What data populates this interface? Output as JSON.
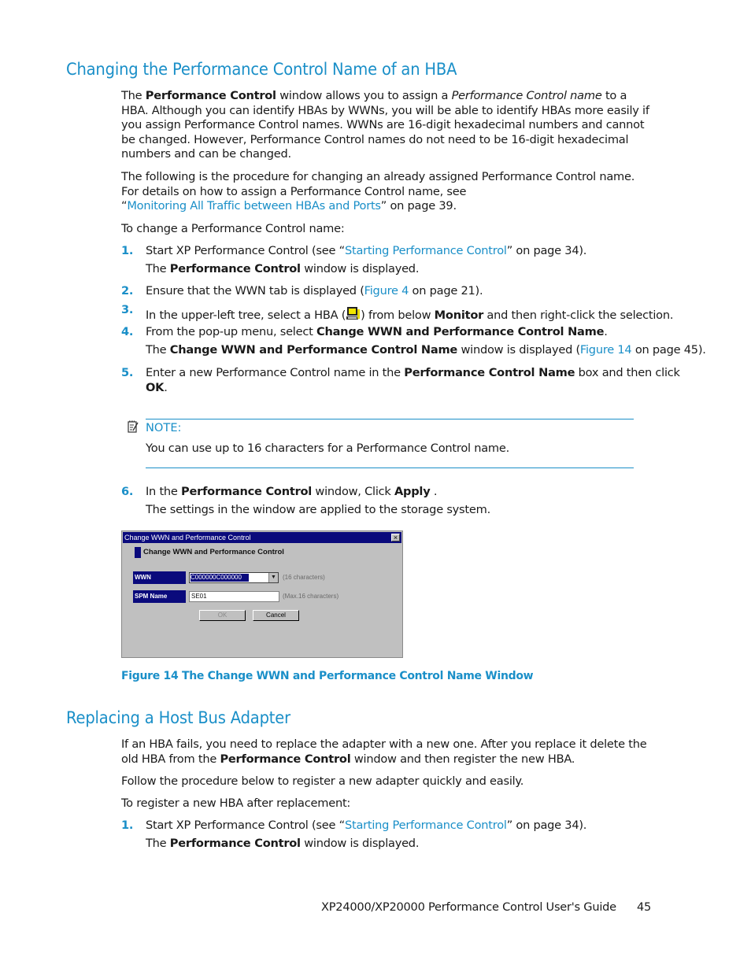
{
  "section1": {
    "heading": "Changing the Performance Control Name of an HBA",
    "para1": {
      "t1": "The ",
      "b1": "Performance Control",
      "t2": " window allows you to assign a ",
      "i1": "Performance Control name",
      "t3": " to a HBA. Although you can identify HBAs by WWNs, you will be able to identify HBAs more easily if you assign Performance Control names. WWNs are 16-digit hexadecimal numbers and cannot be changed. However, Performance Control names do not need to be 16-digit hexadecimal numbers and can be changed."
    },
    "para2": {
      "t1": "The following is the procedure for changing an already assigned Performance Control name. For details on how to assign a Performance Control name, see",
      "q_open": "“",
      "link": "Monitoring All Traffic between HBAs and Ports",
      "t2": "” on page 39."
    },
    "intro": "To change a Performance Control name:",
    "steps": [
      {
        "num": "1.",
        "t1": "Start XP Performance Control (see “",
        "link": "Starting Performance Control",
        "t2": "” on page 34).",
        "sub_t1": "The ",
        "sub_b": "Performance Control",
        "sub_t2": " window is displayed."
      },
      {
        "num": "2.",
        "t1": "Ensure that the WWN tab is displayed (",
        "link": "Figure 4",
        "t2": " on page 21)."
      },
      {
        "num": "3.",
        "t1": "In the upper-left tree, select a HBA (",
        "t2": ") from below ",
        "b": "Monitor",
        "t3": " and then right-click the selection."
      },
      {
        "num": "4.",
        "t1": "From the pop-up menu, select ",
        "b": "Change WWN and Performance Control Name",
        "t2": ".",
        "sub_t1": "The ",
        "sub_b": "Change WWN and Performance Control Name",
        "sub_t2": " window is displayed (",
        "sub_link": "Figure 14",
        "sub_t3": " on page 45)."
      },
      {
        "num": "5.",
        "t1": "Enter a new Performance Control name in the ",
        "b": "Performance Control Name",
        "t2": " box and then click",
        "b2": "OK",
        "t3": "."
      },
      {
        "num": "6.",
        "t1": "In the ",
        "b": "Performance Control",
        "t2": " window, Click ",
        "b2": "Apply",
        "t3": " .",
        "sub": "The settings in the window are applied to the storage system."
      }
    ],
    "note": {
      "label": "NOTE:",
      "text": "You can use up to 16 characters for a Performance Control name."
    }
  },
  "dialog": {
    "title": "Change WWN and Performance Control",
    "close": "×",
    "heading": "Change WWN and  Performance Control",
    "wwn_label": "WWN",
    "wwn_value": "C000000C000000",
    "wwn_arrow": "▼",
    "wwn_hint": "(16 characters)",
    "name_label": "SPM Name",
    "name_value": "SE01",
    "name_hint": "(Max.16 characters)",
    "ok": "OK",
    "cancel": "Cancel"
  },
  "figure_caption": "Figure 14 The Change WWN and Performance Control Name Window",
  "section2": {
    "heading": "Replacing a Host Bus Adapter",
    "para1": {
      "t1": "If an HBA fails, you need to replace the adapter with a new one. After you replace it delete the old HBA from the ",
      "b": "Performance Control",
      "t2": " window and then register the new HBA."
    },
    "para2": "Follow the procedure below to register a new adapter quickly and easily.",
    "intro": "To register a new HBA after replacement:",
    "steps": [
      {
        "num": "1.",
        "t1": "Start XP Performance Control (see “",
        "link": "Starting Performance Control",
        "t2": "” on page 34).",
        "sub_t1": "The ",
        "sub_b": "Performance Control",
        "sub_t2": " window is displayed."
      }
    ]
  },
  "footer": {
    "title": "XP24000/XP20000 Performance Control User's Guide",
    "page": "45"
  },
  "colors": {
    "accent": "#1a8fc8",
    "titlebar": "#0a0a7c",
    "dialog_bg": "#c0c0c0"
  }
}
